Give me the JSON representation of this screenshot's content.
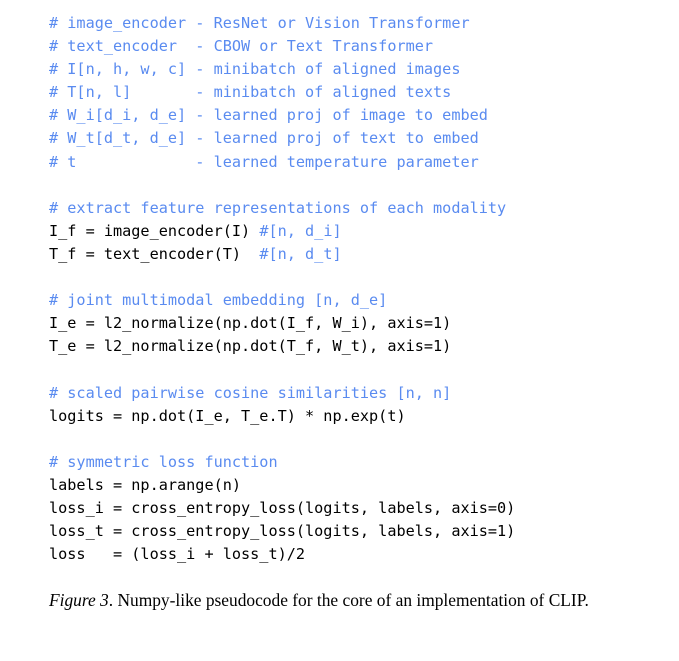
{
  "figure": {
    "colors": {
      "background": "#ffffff",
      "code_text": "#000000",
      "comment_text": "#5a8bf0",
      "caption_text": "#000000"
    },
    "caption": {
      "label": "Figure 3",
      "label_suffix": ". ",
      "text": "Numpy-like pseudocode for the core of an implementation of CLIP."
    },
    "code": {
      "language": "numpy-pseudocode",
      "lines": [
        {
          "segments": [
            {
              "kind": "comment",
              "text": "# image_encoder - ResNet or Vision Transformer"
            }
          ]
        },
        {
          "segments": [
            {
              "kind": "comment",
              "text": "# text_encoder  - CBOW or Text Transformer"
            }
          ]
        },
        {
          "segments": [
            {
              "kind": "comment",
              "text": "# I[n, h, w, c] - minibatch of aligned images"
            }
          ]
        },
        {
          "segments": [
            {
              "kind": "comment",
              "text": "# T[n, l]       - minibatch of aligned texts"
            }
          ]
        },
        {
          "segments": [
            {
              "kind": "comment",
              "text": "# W_i[d_i, d_e] - learned proj of image to embed"
            }
          ]
        },
        {
          "segments": [
            {
              "kind": "comment",
              "text": "# W_t[d_t, d_e] - learned proj of text to embed"
            }
          ]
        },
        {
          "segments": [
            {
              "kind": "comment",
              "text": "# t             - learned temperature parameter"
            }
          ]
        },
        {
          "segments": [
            {
              "kind": "blank",
              "text": ""
            }
          ]
        },
        {
          "segments": [
            {
              "kind": "comment",
              "text": "# extract feature representations of each modality"
            }
          ]
        },
        {
          "segments": [
            {
              "kind": "code",
              "text": "I_f = image_encoder(I) "
            },
            {
              "kind": "comment",
              "text": "#[n, d_i]"
            }
          ]
        },
        {
          "segments": [
            {
              "kind": "code",
              "text": "T_f = text_encoder(T)  "
            },
            {
              "kind": "comment",
              "text": "#[n, d_t]"
            }
          ]
        },
        {
          "segments": [
            {
              "kind": "blank",
              "text": ""
            }
          ]
        },
        {
          "segments": [
            {
              "kind": "comment",
              "text": "# joint multimodal embedding [n, d_e]"
            }
          ]
        },
        {
          "segments": [
            {
              "kind": "code",
              "text": "I_e = l2_normalize(np.dot(I_f, W_i), axis=1)"
            }
          ]
        },
        {
          "segments": [
            {
              "kind": "code",
              "text": "T_e = l2_normalize(np.dot(T_f, W_t), axis=1)"
            }
          ]
        },
        {
          "segments": [
            {
              "kind": "blank",
              "text": ""
            }
          ]
        },
        {
          "segments": [
            {
              "kind": "comment",
              "text": "# scaled pairwise cosine similarities [n, n]"
            }
          ]
        },
        {
          "segments": [
            {
              "kind": "code",
              "text": "logits = np.dot(I_e, T_e.T) * np.exp(t)"
            }
          ]
        },
        {
          "segments": [
            {
              "kind": "blank",
              "text": ""
            }
          ]
        },
        {
          "segments": [
            {
              "kind": "comment",
              "text": "# symmetric loss function"
            }
          ]
        },
        {
          "segments": [
            {
              "kind": "code",
              "text": "labels = np.arange(n)"
            }
          ]
        },
        {
          "segments": [
            {
              "kind": "code",
              "text": "loss_i = cross_entropy_loss(logits, labels, axis=0)"
            }
          ]
        },
        {
          "segments": [
            {
              "kind": "code",
              "text": "loss_t = cross_entropy_loss(logits, labels, axis=1)"
            }
          ]
        },
        {
          "segments": [
            {
              "kind": "code",
              "text": "loss   = (loss_i + loss_t)/2"
            }
          ]
        }
      ]
    }
  }
}
